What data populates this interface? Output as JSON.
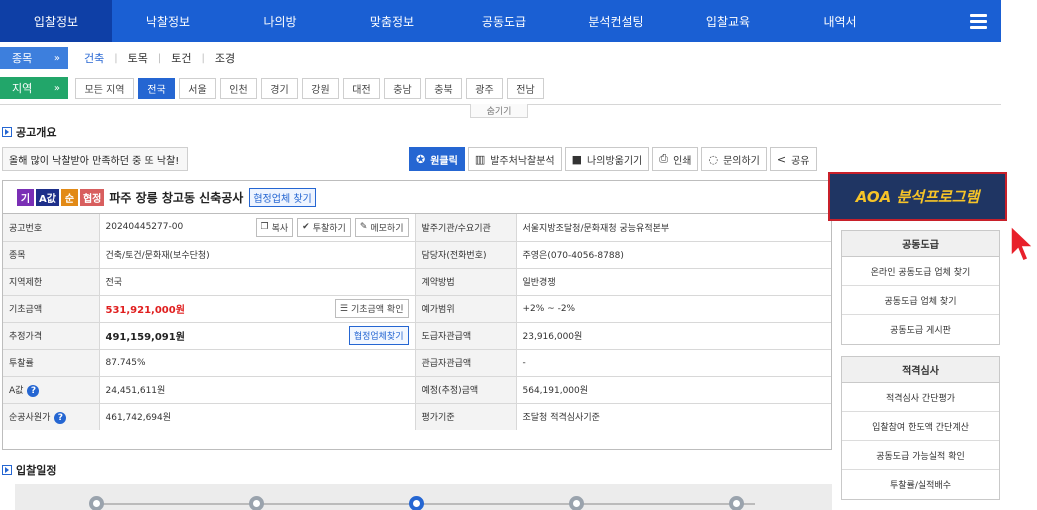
{
  "nav": {
    "items": [
      "입찰정보",
      "낙찰정보",
      "나의방",
      "맞춤정보",
      "공동도급",
      "분석컨설팅",
      "입찰교육",
      "내역서"
    ],
    "menu_icon": "hamburger-icon"
  },
  "filters": {
    "category_label": "종목",
    "category_chevron": "»",
    "categories": [
      "건축",
      "토목",
      "토건",
      "조경"
    ],
    "region_label": "지역",
    "region_chevron": "»",
    "regions": [
      "모든 지역",
      "전국",
      "서울",
      "인천",
      "경기",
      "강원",
      "대전",
      "충남",
      "충북",
      "광주",
      "전남"
    ],
    "hide_label": "숨기기"
  },
  "notice": {
    "section_title": "공고개요",
    "banner_text": "올해 많이 낙찰받아 만족하던 중 또 낙찰!"
  },
  "actions": {
    "one_click": "원클릭",
    "analysis": "발주처낙찰분석",
    "save": "나의방옮기기",
    "print": "인쇄",
    "inquiry": "문의하기",
    "share": "공유"
  },
  "bid": {
    "badges": [
      "기",
      "A값",
      "순",
      "협정"
    ],
    "title": "파주 장릉 창고동 신축공사",
    "title_link": "협정업체 찾기"
  },
  "info": {
    "rows": [
      {
        "th1": "공고번호",
        "v1": "20240445277-00",
        "th2": "발주기관/수요기관",
        "v2": "서울지방조달청/문화재청 궁능유적본부"
      },
      {
        "th1": "종목",
        "v1": "건축/토건/문화재(보수단청)",
        "th2": "담당자(전화번호)",
        "v2": "주영은(070-4056-8788)"
      },
      {
        "th1": "지역제한",
        "v1": "전국",
        "th2": "계약방법",
        "v2": "일반경쟁"
      },
      {
        "th1": "기초금액",
        "v1": "531,921,000원",
        "th2": "예가범위",
        "v2": "+2% ~ -2%"
      },
      {
        "th1": "추정가격",
        "v1": "491,159,091원",
        "th2": "도급자관급액",
        "v2": "23,916,000원"
      },
      {
        "th1": "투찰률",
        "v1": "87.745%",
        "th2": "관급자관급액",
        "v2": "-"
      },
      {
        "th1": "A값",
        "v1": "24,451,611원",
        "th2": "예정(추정)금액",
        "v2": "564,191,000원"
      },
      {
        "th1": "순공사원가",
        "v1": "461,742,694원",
        "th2": "평가기준",
        "v2": "조달청 적격심사기준"
      }
    ],
    "copy_btn": "복사",
    "bid_btn": "투찰하기",
    "memo_btn": "메모하기",
    "base_confirm_btn": "기초금액 확인",
    "partner_btn": "협정업체찾기"
  },
  "schedule": {
    "section_title": "입찰일정"
  },
  "side": {
    "banner": "AOA 분석프로그램",
    "joint_head": "공동도급",
    "joint_items": [
      "온라인 공동도급 업체 찾기",
      "공동도급 업체 찾기",
      "공동도급 게시판"
    ],
    "qual_head": "적격심사",
    "qual_items": [
      "적격심사 간단평가",
      "입찰참여 한도액 간단계산",
      "공동도급 가능실적 확인",
      "투찰률/실적배수"
    ]
  },
  "colors": {
    "nav_bg": "#1a5fd3",
    "nav_active": "#0e3fa6",
    "accent": "#2566d2",
    "region_label": "#22a66a",
    "price_red": "#e01e1e",
    "banner_bg": "#1f3563",
    "banner_text": "#f6c428"
  }
}
